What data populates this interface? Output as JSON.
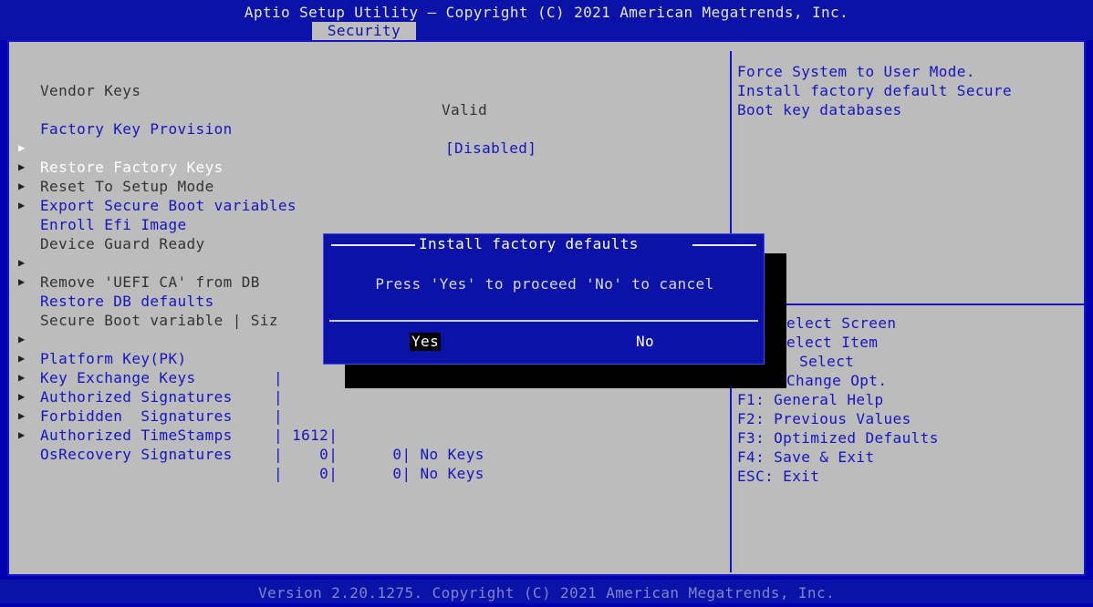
{
  "header": {
    "title": "Aptio Setup Utility – Copyright (C) 2021 American Megatrends, Inc.",
    "active_tab": "Security"
  },
  "left": {
    "vendor_keys_label": "Vendor Keys",
    "vendor_keys_value": "Valid",
    "factory_key_label": "Factory Key Provision",
    "factory_key_value": "[Disabled]",
    "items": [
      "Restore Factory Keys",
      "Reset To Setup Mode",
      "Export Secure Boot variables",
      "Enroll Efi Image"
    ],
    "device_guard_label": "Device Guard Ready",
    "device_guard_items": [
      "Remove 'UEFI CA' from DB",
      "Restore DB defaults"
    ],
    "table_header": "Secure Boot variable | Siz",
    "table_rows": [
      {
        "name": "Platform Key(PK)",
        "pipe": "|"
      },
      {
        "name": "Key Exchange Keys",
        "pipe": "|"
      },
      {
        "name": "Authorized Signatures",
        "pipe": "|"
      },
      {
        "name": "Forbidden  Signatures",
        "pipe": "| 1612|"
      },
      {
        "name": "Authorized TimeStamps",
        "pipe": "|    0|      0| No Keys"
      },
      {
        "name": "OsRecovery Signatures",
        "pipe": "|    0|      0| No Keys"
      }
    ]
  },
  "help": {
    "description": [
      "Force System to User Mode.",
      "Install factory default Secure",
      "Boot key databases"
    ],
    "keys": [
      "elect Screen",
      "elect Item",
      ": Select",
      "Change Opt.",
      "F1: General Help",
      "F2: Previous Values",
      "F3: Optimized Defaults",
      "F4: Save & Exit",
      "ESC: Exit"
    ]
  },
  "dialog": {
    "title": "Install factory defaults",
    "message": "Press 'Yes' to proceed 'No' to cancel",
    "yes_label": "Yes",
    "no_label": "No"
  },
  "footer": {
    "text": "Version 2.20.1275. Copyright (C) 2021 American Megatrends, Inc."
  },
  "colors": {
    "background_blue": "#0a12a8",
    "panel_gray": "#bcbcbc",
    "highlight_text": "#ffffff",
    "item_text_blue": "#1515c0"
  }
}
